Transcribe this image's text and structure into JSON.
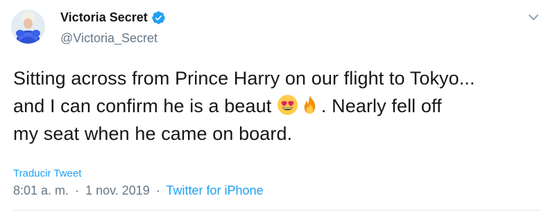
{
  "author": {
    "name": "Victoria Secret",
    "handle": "@Victoria_Secret",
    "verified": true
  },
  "icons": {
    "verified": "verified-badge-icon",
    "menu": "chevron-down-icon",
    "emoji_1": "heart-eyes-emoji",
    "emoji_2": "fire-emoji"
  },
  "tweet": {
    "line_1": "Sitting across from Prince Harry on our flight to Tokyo...",
    "line_2_before": "and I can confirm he is a beaut ",
    "line_2_after": ". Nearly fell off",
    "line_3": "my seat when he came on board."
  },
  "translate_label": "Traducir Tweet",
  "meta": {
    "time": "8:01 a. m.",
    "separator": "·",
    "date": "1 nov. 2019",
    "source": "Twitter for iPhone"
  },
  "colors": {
    "link": "#1da1f2",
    "secondary_text": "#657786",
    "primary_text": "#14171a",
    "verified_badge": "#1da1f2"
  }
}
